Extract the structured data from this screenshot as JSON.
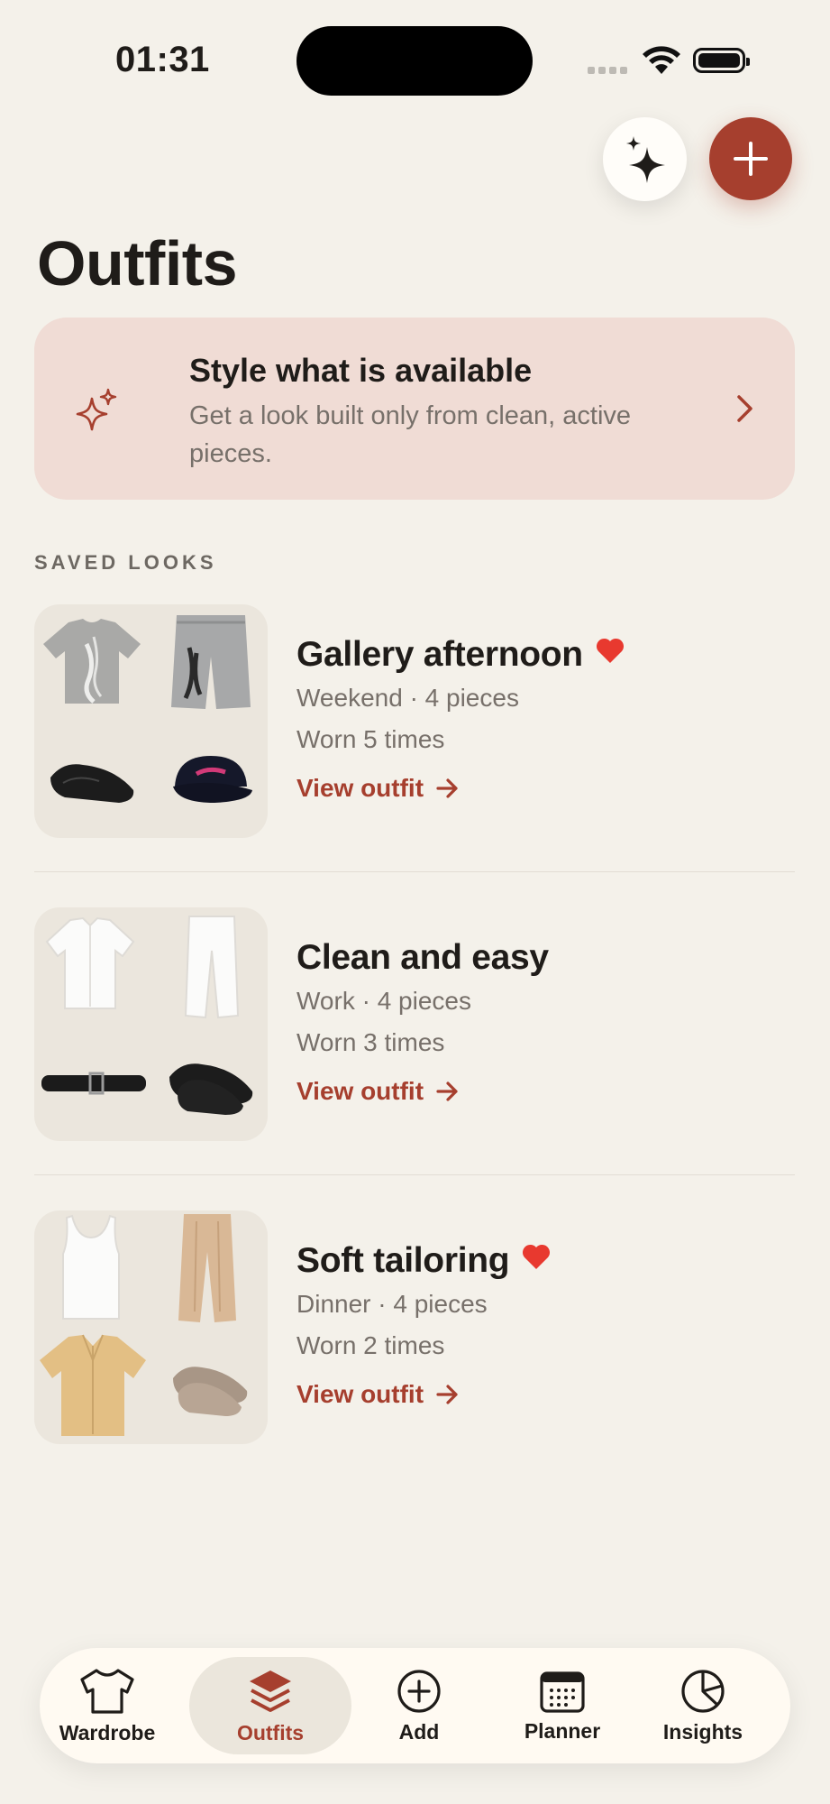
{
  "status_bar": {
    "time": "01:31"
  },
  "header": {
    "title": "Outfits",
    "sparkle_icon": "sparkles-icon",
    "add_icon": "plus-icon"
  },
  "banner": {
    "title": "Style what is available",
    "subtitle": "Get a look built only from clean, active pieces.",
    "icon": "sparkles-icon"
  },
  "section": {
    "label": "SAVED LOOKS"
  },
  "outfits": [
    {
      "name": "Gallery afternoon",
      "meta": "Weekend · 4 pieces",
      "worn": "Worn 5 times",
      "link": "View outfit",
      "favorite": true
    },
    {
      "name": "Clean and easy",
      "meta": "Work · 4 pieces",
      "worn": "Worn 3 times",
      "link": "View outfit",
      "favorite": false
    },
    {
      "name": "Soft tailoring",
      "meta": "Dinner · 4 pieces",
      "worn": "Worn 2 times",
      "link": "View outfit",
      "favorite": true
    }
  ],
  "tabbar": {
    "items": [
      {
        "label": "Wardrobe",
        "icon": "tshirt-icon"
      },
      {
        "label": "Outfits",
        "icon": "layers-icon",
        "active": true
      },
      {
        "label": "Add",
        "icon": "plus-circle-icon"
      },
      {
        "label": "Planner",
        "icon": "calendar-icon"
      },
      {
        "label": "Insights",
        "icon": "pie-chart-icon"
      }
    ]
  },
  "colors": {
    "accent": "#a63f2e",
    "background": "#f4f1ea",
    "banner": "#f0dcd5",
    "heart": "#e8392f"
  }
}
